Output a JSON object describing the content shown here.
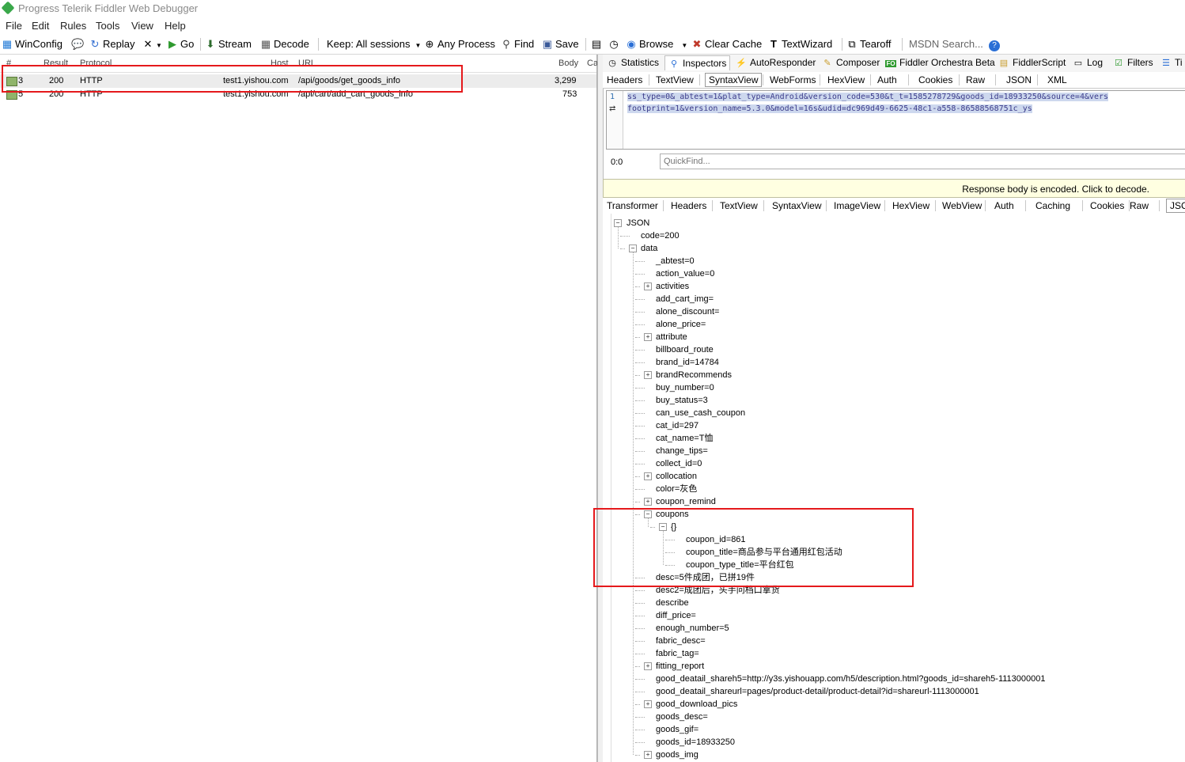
{
  "window": {
    "title": "Progress Telerik Fiddler Web Debugger"
  },
  "menu": [
    "File",
    "Edit",
    "Rules",
    "Tools",
    "View",
    "Help"
  ],
  "toolbar": {
    "winconfig": "WinConfig",
    "replay": "Replay",
    "go": "Go",
    "stream": "Stream",
    "decode": "Decode",
    "keep": "Keep: All sessions",
    "any_process": "Any Process",
    "find": "Find",
    "save": "Save",
    "browse": "Browse",
    "clear_cache": "Clear Cache",
    "textwizard": "TextWizard",
    "tearoff": "Tearoff",
    "msdn_search": "MSDN Search..."
  },
  "sessions": {
    "columns": [
      "#",
      "Result",
      "Protocol",
      "Host",
      "URL",
      "Body",
      "Ca"
    ],
    "rows": [
      {
        "num": "3",
        "result": "200",
        "protocol": "HTTP",
        "host": "test1.yishou.com",
        "url": "/api/goods/get_goods_info",
        "body": "3,299"
      },
      {
        "num": "5",
        "result": "200",
        "protocol": "HTTP",
        "host": "test1.yishou.com",
        "url": "/api/cart/add_cart_goods_info",
        "body": "753"
      }
    ]
  },
  "inspector_tabs": [
    "Statistics",
    "Inspectors",
    "AutoResponder",
    "Composer",
    "Fiddler Orchestra Beta",
    "FiddlerScript",
    "Log",
    "Filters",
    "Ti"
  ],
  "request_tabs": [
    "Headers",
    "TextView",
    "SyntaxView",
    "WebForms",
    "HexView",
    "Auth",
    "Cookies",
    "Raw",
    "JSON",
    "XML"
  ],
  "request_body": {
    "line_no": "1",
    "line1": "ss_type=0&_abtest=1&plat_type=Android&version_code=530&t_t=1585278729&goods_id=18933250&source=4&vers",
    "line2": "footprint=1&version_name=5.3.0&model=16s&udid=dc969d49-6625-48c1-a558-86588568751c_ys"
  },
  "findbar": {
    "position": "0:0",
    "placeholder": "QuickFind..."
  },
  "banner": "Response body is encoded. Click to decode.",
  "response_tabs": [
    "Transformer",
    "Headers",
    "TextView",
    "SyntaxView",
    "ImageView",
    "HexView",
    "WebView",
    "Auth",
    "Caching",
    "Cookies",
    "Raw",
    "JSC"
  ],
  "tree": [
    {
      "text": "JSON",
      "level": 0,
      "exp": "-"
    },
    {
      "text": "code=200",
      "level": 1
    },
    {
      "text": "data",
      "level": 1,
      "exp": "-"
    },
    {
      "text": "_abtest=0",
      "level": 2
    },
    {
      "text": "action_value=0",
      "level": 2
    },
    {
      "text": "activities",
      "level": 2,
      "exp": "+"
    },
    {
      "text": "add_cart_img=",
      "level": 2
    },
    {
      "text": "alone_discount=",
      "level": 2
    },
    {
      "text": "alone_price=",
      "level": 2
    },
    {
      "text": "attribute",
      "level": 2,
      "exp": "+"
    },
    {
      "text": "billboard_route",
      "level": 2
    },
    {
      "text": "brand_id=14784",
      "level": 2
    },
    {
      "text": "brandRecommends",
      "level": 2,
      "exp": "+"
    },
    {
      "text": "buy_number=0",
      "level": 2
    },
    {
      "text": "buy_status=3",
      "level": 2
    },
    {
      "text": "can_use_cash_coupon",
      "level": 2
    },
    {
      "text": "cat_id=297",
      "level": 2
    },
    {
      "text": "cat_name=T恤",
      "level": 2
    },
    {
      "text": "change_tips=",
      "level": 2
    },
    {
      "text": "collect_id=0",
      "level": 2
    },
    {
      "text": "collocation",
      "level": 2,
      "exp": "+"
    },
    {
      "text": "color=灰色",
      "level": 2
    },
    {
      "text": "coupon_remind",
      "level": 2,
      "exp": "+"
    },
    {
      "text": "coupons",
      "level": 2,
      "exp": "-"
    },
    {
      "text": "{}",
      "level": 3,
      "exp": "-"
    },
    {
      "text": "coupon_id=861",
      "level": 4
    },
    {
      "text": "coupon_title=商品参与平台通用红包活动",
      "level": 4
    },
    {
      "text": "coupon_type_title=平台红包",
      "level": 4
    },
    {
      "text": "desc=5件成团，已拼19件",
      "level": 2
    },
    {
      "text": "desc2=成团后，头手问档口拿货",
      "level": 2
    },
    {
      "text": "describe",
      "level": 2
    },
    {
      "text": "diff_price=",
      "level": 2
    },
    {
      "text": "enough_number=5",
      "level": 2
    },
    {
      "text": "fabric_desc=",
      "level": 2
    },
    {
      "text": "fabric_tag=",
      "level": 2
    },
    {
      "text": "fitting_report",
      "level": 2,
      "exp": "+"
    },
    {
      "text": "good_deatail_shareh5=http://y3s.yishouapp.com/h5/description.html?goods_id=shareh5-1113000001",
      "level": 2
    },
    {
      "text": "good_deatail_shareurl=pages/product-detail/product-detail?id=shareurl-1113000001",
      "level": 2
    },
    {
      "text": "good_download_pics",
      "level": 2,
      "exp": "+"
    },
    {
      "text": "goods_desc=",
      "level": 2
    },
    {
      "text": "goods_gif=",
      "level": 2
    },
    {
      "text": "goods_id=18933250",
      "level": 2
    },
    {
      "text": "goods_img",
      "level": 2,
      "exp": "+"
    }
  ],
  "colors": {
    "highlight": "#e5191c",
    "banner_bg": "#ffffe1",
    "selected_row": "#ececec"
  }
}
